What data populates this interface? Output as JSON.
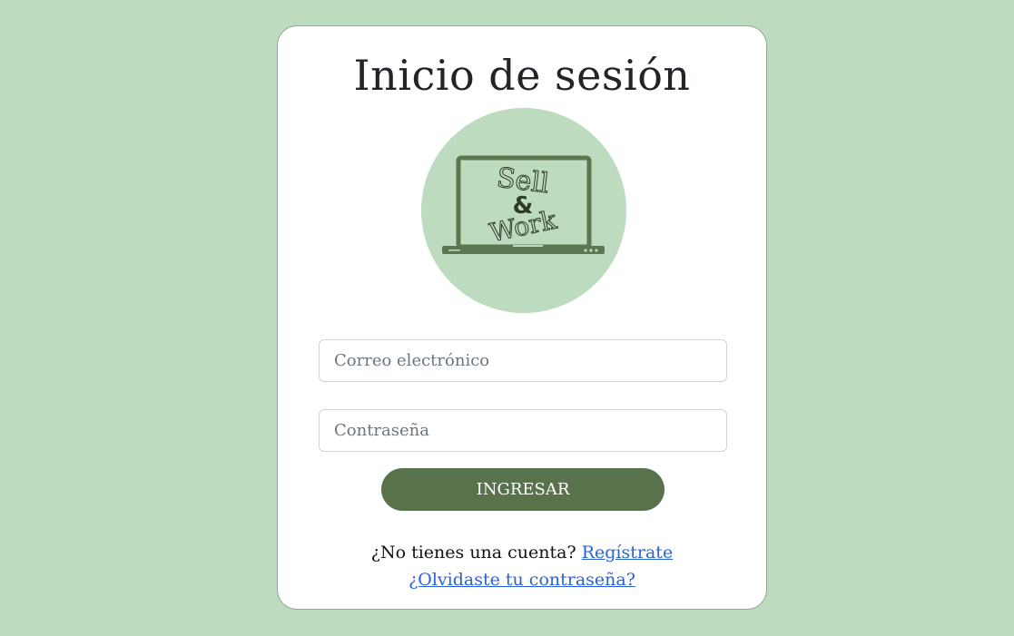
{
  "login": {
    "title": "Inicio de sesión",
    "logo": {
      "word1": "Sell",
      "ampersand": "&",
      "word2": "Work"
    },
    "email_placeholder": "Correo electrónico",
    "password_placeholder": "Contraseña",
    "submit_label": "INGRESAR",
    "no_account_text": "¿No tienes una cuenta?",
    "register_link": "Regístrate",
    "forgot_link": "¿Olvidaste tu contraseña?"
  },
  "colors": {
    "background": "#bddbbf",
    "button": "#58734b",
    "link": "#2a63d6",
    "logo_circle": "#bddbbf",
    "logo_laptop": "#5c7650"
  }
}
